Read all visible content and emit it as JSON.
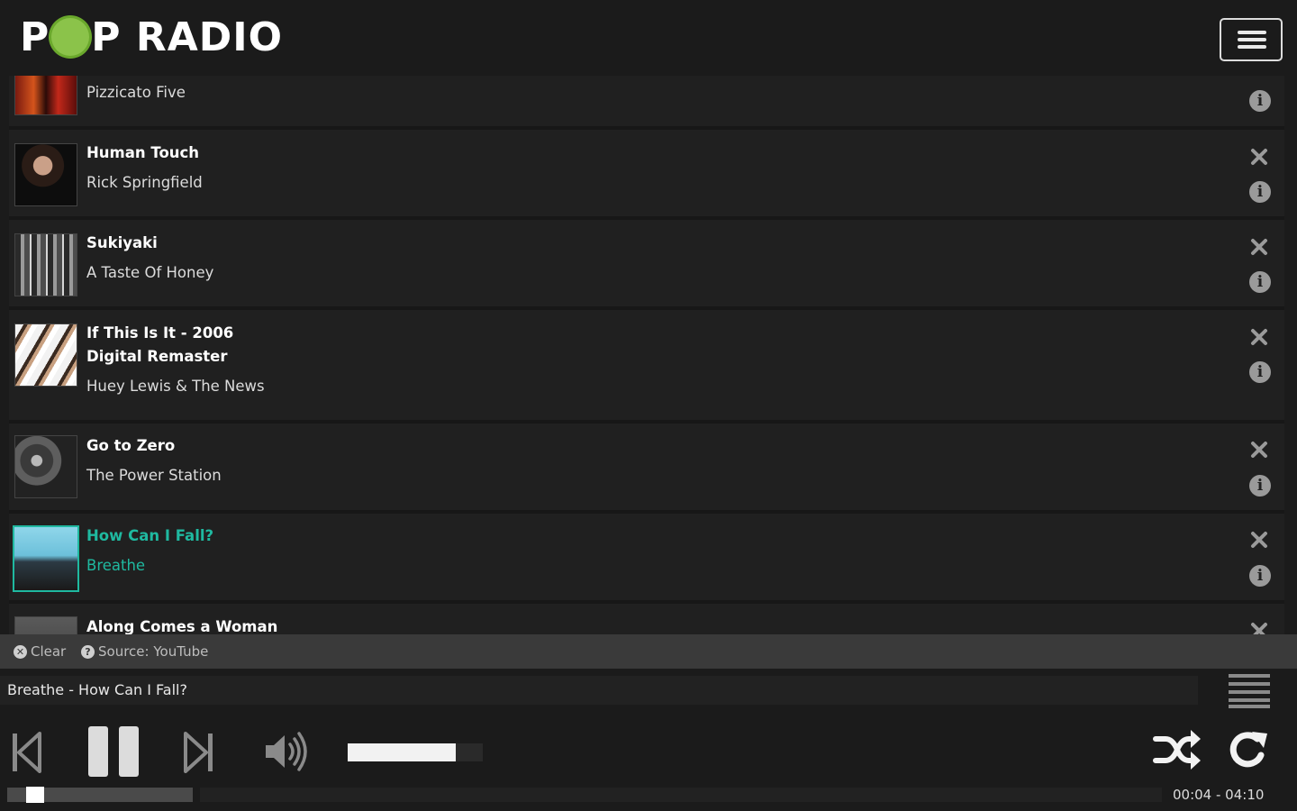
{
  "app": {
    "logo_text": "POP RADIO"
  },
  "playlist": [
    {
      "title": "",
      "artist": "Pizzicato Five",
      "active": false
    },
    {
      "title": "Human Touch",
      "artist": "Rick Springfield",
      "active": false
    },
    {
      "title": "Sukiyaki",
      "artist": "A Taste Of Honey",
      "active": false
    },
    {
      "title": "If This Is It - 2006 Digital Remaster",
      "artist": "Huey Lewis & The News",
      "active": false
    },
    {
      "title": "Go to Zero",
      "artist": "The Power Station",
      "active": false
    },
    {
      "title": "How Can I Fall?",
      "artist": "Breathe",
      "active": true
    },
    {
      "title": "Along Comes a Woman",
      "artist": "",
      "active": false
    }
  ],
  "toolbar": {
    "clear_label": "Clear",
    "source_label": "Source: YouTube"
  },
  "player": {
    "now_playing": "Breathe - How Can I Fall?",
    "time": "00:04 - 04:10",
    "volume_fraction": 0.8,
    "progress_fraction": 0.016
  },
  "colors": {
    "accent": "#1fb9a0",
    "background": "#1b1b1b",
    "row": "#202020",
    "logo_dot": "#8bc34a"
  },
  "icons": [
    "menu-icon",
    "close-icon",
    "info-icon",
    "clear-icon",
    "help-icon",
    "previous-icon",
    "pause-icon",
    "next-icon",
    "volume-icon",
    "playlist-icon",
    "shuffle-icon",
    "repeat-icon"
  ]
}
